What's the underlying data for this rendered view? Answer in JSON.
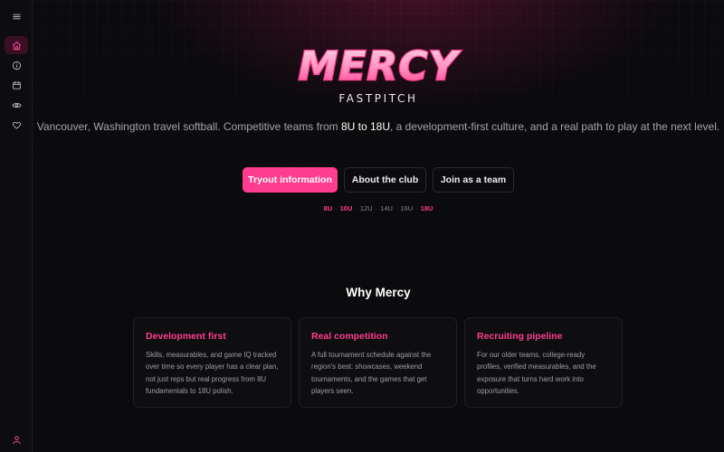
{
  "sidebar": {
    "icons": [
      "menu-icon",
      "home-icon",
      "info-icon",
      "calendar-icon",
      "eye-icon",
      "heart-icon",
      "user-icon"
    ],
    "accent": "#ff4f9a"
  },
  "hero": {
    "logo_text": "MERCY",
    "logo_subtitle": "FASTPITCH",
    "tagline": {
      "part1": "Vancouver, Washington travel softball. Competitive teams from ",
      "highlight": "8U to 18U",
      "part2": ", a development-first culture, and a real path to play at the next level."
    },
    "buttons": {
      "primary": "Tryout information",
      "about": "About the club",
      "join": "Join as a team"
    },
    "ages": [
      {
        "label": "8U",
        "active": true
      },
      {
        "label": "10U",
        "active": true
      },
      {
        "label": "12U",
        "active": false
      },
      {
        "label": "14U",
        "active": false
      },
      {
        "label": "16U",
        "active": false
      },
      {
        "label": "18U",
        "active": true
      }
    ],
    "age_separator": "·"
  },
  "why": {
    "title": "Why Mercy",
    "cards": [
      {
        "title": "Development first",
        "body": "Skills, measurables, and game IQ tracked over time so every player has a clear plan, not just reps but real progress from 8U fundamentals to 18U polish."
      },
      {
        "title": "Real competition",
        "body": "A full tournament schedule against the region's best: showcases, weekend tournaments, and the games that get players seen."
      },
      {
        "title": "Recruiting pipeline",
        "body": "For our older teams, college-ready profiles, verified measurables, and the exposure that turns hard work into opportunities."
      }
    ]
  },
  "colors": {
    "accent": "#ff3d8f",
    "background": "#0b0a0c",
    "card_border": "#231f26"
  }
}
